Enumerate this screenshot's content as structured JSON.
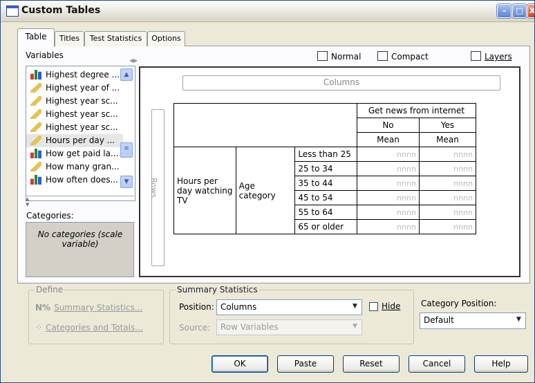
{
  "window": {
    "title": "Custom Tables",
    "minimize": "–",
    "maximize": "□",
    "close": "X"
  },
  "tabs": [
    {
      "label": "Table"
    },
    {
      "label": "Titles"
    },
    {
      "label": "Test Statistics"
    },
    {
      "label": "Options"
    }
  ],
  "variables": {
    "label": "Variables",
    "items": [
      {
        "label": "Highest degree ...",
        "icon": "nominal-bar-icon"
      },
      {
        "label": "Highest year of ...",
        "icon": "scale-ruler-icon"
      },
      {
        "label": "Highest year sc...",
        "icon": "scale-ruler-icon"
      },
      {
        "label": "Highest year sc...",
        "icon": "scale-ruler-icon"
      },
      {
        "label": "Highest year sc...",
        "icon": "scale-ruler-icon"
      },
      {
        "label": "Hours per day ...",
        "icon": "scale-ruler-icon",
        "selected": true
      },
      {
        "label": "How get paid la...",
        "icon": "nominal-bar-icon"
      },
      {
        "label": "How many gran...",
        "icon": "scale-ruler-icon"
      },
      {
        "label": "How often does...",
        "icon": "nominal-bar-icon"
      }
    ]
  },
  "categories": {
    "label": "Categories:",
    "text": "No categories (scale variable)"
  },
  "views": {
    "normal": "Normal",
    "compact": "Compact",
    "layers": "Layers"
  },
  "canvas": {
    "columns_label": "Columns",
    "rows_label": "Rows",
    "table": {
      "col_var": "Get news from internet",
      "col_cats": [
        "No",
        "Yes"
      ],
      "stat": "Mean",
      "row_var": "Hours per day watching TV",
      "row_sub_var": "Age category",
      "row_cats": [
        "Less than 25",
        "25 to 34",
        "35 to 44",
        "45 to 54",
        "55 to 64",
        "65 or older"
      ],
      "cell": "nnnn"
    }
  },
  "define": {
    "title": "Define",
    "summary": "Summary Statistics...",
    "categories": "Categories and Totals..."
  },
  "summary_statistics": {
    "title": "Summary Statistics",
    "position_label": "Position:",
    "position_value": "Columns",
    "hide_label": "Hide",
    "source_label": "Source:",
    "source_value": "Row Variables"
  },
  "category_position": {
    "label": "Category Position:",
    "value": "Default"
  },
  "buttons": {
    "ok": "OK",
    "paste": "Paste",
    "reset": "Reset",
    "cancel": "Cancel",
    "help": "Help"
  }
}
